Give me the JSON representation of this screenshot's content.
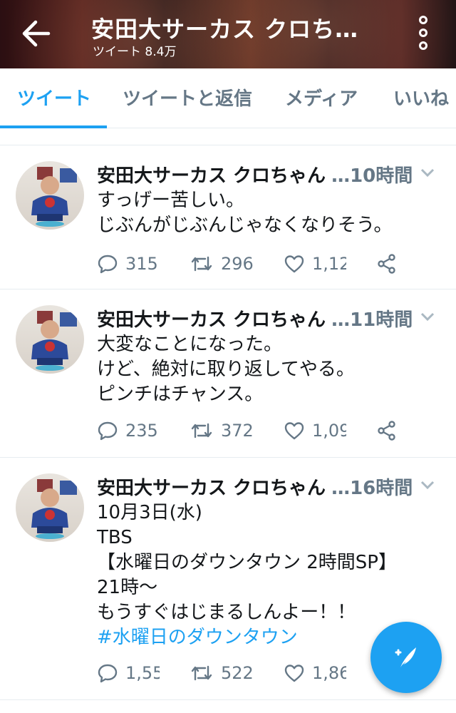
{
  "header": {
    "title": "安田大サーカス クロち…",
    "subtitle": "ツイート 8.4万",
    "icons": {
      "back": "arrow-left-icon",
      "more": "more-vertical-icon"
    }
  },
  "tabs": [
    {
      "label": "ツイート",
      "active": true
    },
    {
      "label": "ツイートと返信",
      "active": false
    },
    {
      "label": "メディア",
      "active": false
    },
    {
      "label": "いいね",
      "active": false
    }
  ],
  "tweets": [
    {
      "author": "安田大サーカス クロちゃん",
      "time": "…10時間",
      "lines": [
        "すっげー苦しい。",
        "じぶんがじぶんじゃなくなりそう。"
      ],
      "replies": "315",
      "retweets": "296",
      "likes": "1,12"
    },
    {
      "author": "安田大サーカス クロちゃん",
      "time": "…11時間",
      "lines": [
        "大変なことになった。",
        "けど、絶対に取り返してやる。",
        "ピンチはチャンス。"
      ],
      "replies": "235",
      "retweets": "372",
      "likes": "1,09"
    },
    {
      "author": "安田大サーカス クロちゃん",
      "time": "…16時間",
      "lines": [
        "10月3日(水)",
        "TBS",
        "【水曜日のダウンタウン 2時間SP】",
        "21時〜",
        "もうすぐはじまるしんよー！！"
      ],
      "hashtag": "#水曜日のダウンタウン",
      "replies": "1,55",
      "retweets": "522",
      "likes": "1,86"
    }
  ],
  "fab": {
    "icon": "compose-tweet-icon"
  },
  "colors": {
    "accent": "#1da1f2",
    "muted": "#657786",
    "text": "#14171a",
    "border": "#e6ecf0"
  }
}
